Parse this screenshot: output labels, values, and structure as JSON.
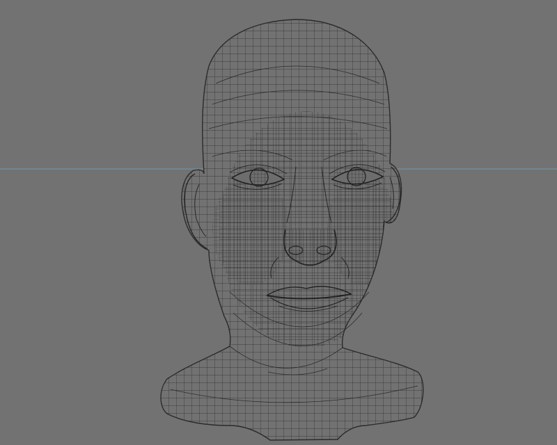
{
  "viewport": {
    "background_color": "#727272",
    "wire_color": "#2b2b2b",
    "guide_color": "#6f98b4"
  },
  "scene": {
    "object": "head-wireframe-mesh",
    "shading": "wireframe"
  }
}
